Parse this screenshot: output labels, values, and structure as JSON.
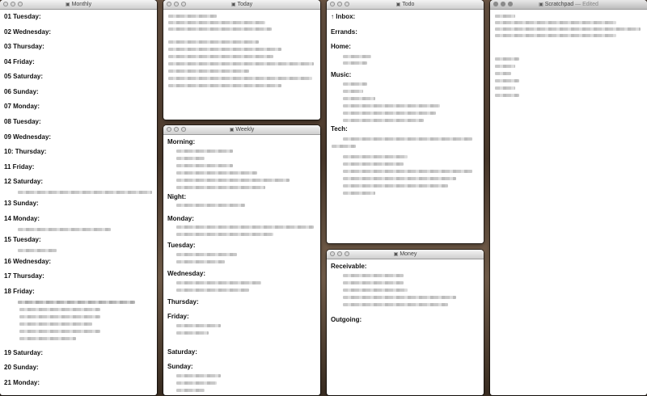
{
  "windows": {
    "monthly": {
      "title": "Monthly"
    },
    "today": {
      "title": "Today"
    },
    "weekly": {
      "title": "Weekly"
    },
    "todo": {
      "title": "Todo"
    },
    "money": {
      "title": "Money"
    },
    "scratchpad": {
      "title": "Scratchpad",
      "status": "— Edited"
    }
  },
  "monthly": {
    "days": [
      "01 Tuesday:",
      "02 Wednesday:",
      "03 Thursday:",
      "04 Friday:",
      "05 Saturday:",
      "06 Sunday:",
      "07 Monday:",
      "08 Tuesday:",
      "09 Wednesday:",
      "10: Thursday:",
      "11 Friday:",
      "12 Saturday:",
      "13 Sunday:",
      "14 Monday:",
      "15 Tuesday:",
      "16 Wednesday:",
      "17 Thursday:",
      "18 Friday:",
      "19 Saturday:",
      "20 Sunday:",
      "21 Monday:"
    ]
  },
  "weekly": {
    "sections": [
      "Morning:",
      "Night:",
      "Monday:",
      "Tuesday:",
      "Wednesday:",
      "Thursday:",
      "Friday:",
      "Saturday:",
      "Sunday:"
    ]
  },
  "todo": {
    "sections": [
      "↑ Inbox:",
      "Errands:",
      "Home:",
      "Music:",
      "Tech:"
    ]
  },
  "money": {
    "sections": [
      "Receivable:",
      "Outgoing:"
    ]
  }
}
